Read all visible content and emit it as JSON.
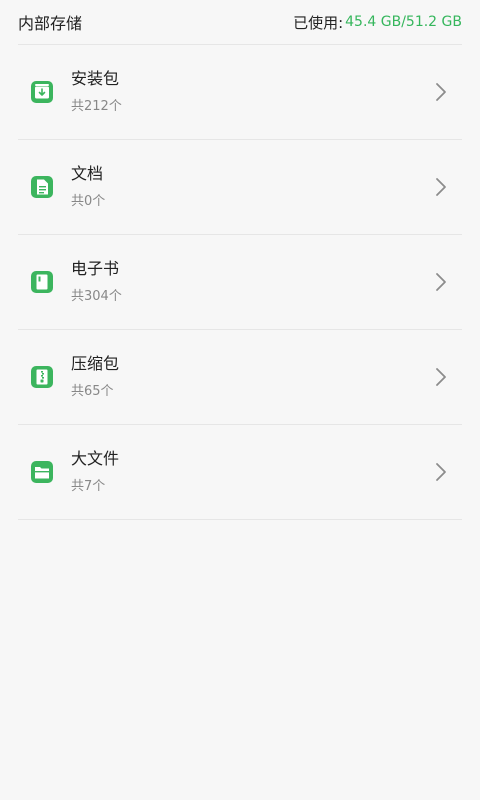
{
  "header": {
    "title": "内部存储",
    "usage_label": "已使用:",
    "usage_value": "45.4 GB/51.2 GB",
    "usage_color": "#35b65c"
  },
  "categories": [
    {
      "title": "安装包",
      "count": "共212个",
      "icon": "package-icon"
    },
    {
      "title": "文档",
      "count": "共0个",
      "icon": "document-icon"
    },
    {
      "title": "电子书",
      "count": "共304个",
      "icon": "ebook-icon"
    },
    {
      "title": "压缩包",
      "count": "共65个",
      "icon": "archive-icon"
    },
    {
      "title": "大文件",
      "count": "共7个",
      "icon": "large-file-icon"
    }
  ],
  "accent_color": "#3cb55e",
  "icon_names": {
    "chevron": "chevron-right-icon"
  }
}
